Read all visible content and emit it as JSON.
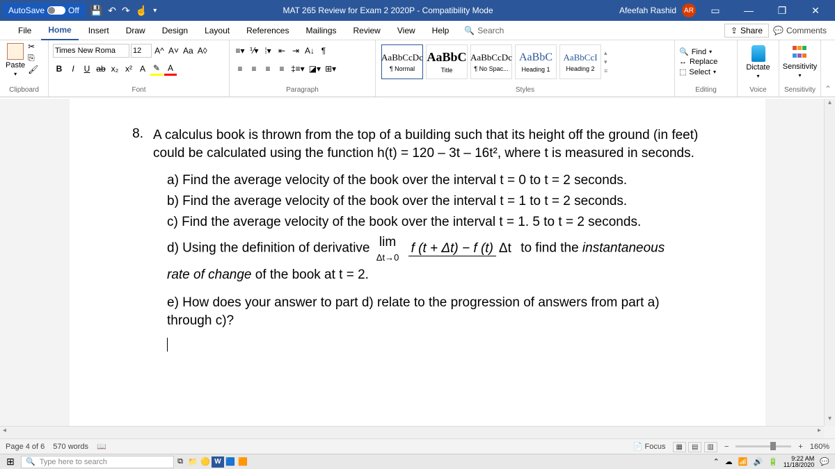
{
  "titlebar": {
    "autosave_label": "AutoSave",
    "autosave_state": "Off",
    "doc_title": "MAT 265 Review for Exam 2 2020P - Compatibility Mode",
    "user_name": "Afeefah Rashid",
    "user_initials": "AR"
  },
  "tabs": [
    "File",
    "Home",
    "Insert",
    "Draw",
    "Design",
    "Layout",
    "References",
    "Mailings",
    "Review",
    "View",
    "Help"
  ],
  "active_tab": "Home",
  "search_placeholder": "Search",
  "share_label": "Share",
  "comments_label": "Comments",
  "ribbon": {
    "clipboard": {
      "label": "Clipboard",
      "paste": "Paste"
    },
    "font": {
      "label": "Font",
      "family": "Times New Roma",
      "size": "12",
      "grow": "A^",
      "shrink": "A˅",
      "case": "Aa",
      "clear": "A◊",
      "bold": "B",
      "italic": "I",
      "underline": "U",
      "strike": "ab",
      "sub": "x₂",
      "sup": "x²",
      "effects": "A",
      "highlight": "✎",
      "color": "A"
    },
    "paragraph": {
      "label": "Paragraph"
    },
    "styles": {
      "label": "Styles",
      "items": [
        {
          "sample": "AaBbCcDc",
          "name": "¶ Normal"
        },
        {
          "sample": "AaBbC",
          "name": "Title"
        },
        {
          "sample": "AaBbCcDc",
          "name": "¶ No Spac..."
        },
        {
          "sample": "AaBbC",
          "name": "Heading 1"
        },
        {
          "sample": "AaBbCcI",
          "name": "Heading 2"
        }
      ]
    },
    "editing": {
      "label": "Editing",
      "find": "Find",
      "replace": "Replace",
      "select": "Select"
    },
    "voice": {
      "label": "Voice",
      "dictate": "Dictate"
    },
    "sensitivity": {
      "label": "Sensitivity",
      "btn": "Sensitivity"
    }
  },
  "doc": {
    "q_num": "8.",
    "q_text": "A calculus book is thrown from the top of a building such that its height off the ground (in feet) could be calculated using the function h(t) = 120 – 3t – 16t², where t is measured in seconds.",
    "a": "a)  Find the average velocity of the book over the interval t = 0 to t = 2 seconds.",
    "b": "b)  Find the average velocity of the book over the interval t = 1 to t = 2 seconds.",
    "c": "c)  Find the average velocity of the book over the interval t = 1. 5 to t = 2 seconds.",
    "d_pre": "d)  Using the definition of derivative ",
    "d_lim_top": "lim",
    "d_lim_bot": "Δt→0",
    "d_frac_top": "f (t + Δt) − f (t)",
    "d_frac_bot": "Δt",
    "d_post": " to find the ",
    "d_inst": "instantaneous",
    "d_line2_pre": "rate of change",
    "d_line2_post": " of the book at t = 2.",
    "e": "e)  How does your answer to part d) relate to the progression of answers from part a) through c)?"
  },
  "status": {
    "page": "Page 4 of 6",
    "words": "570 words",
    "focus": "Focus",
    "zoom": "160%"
  },
  "taskbar": {
    "search": "Type here to search",
    "time": "9:22 AM",
    "date": "11/18/2020"
  }
}
